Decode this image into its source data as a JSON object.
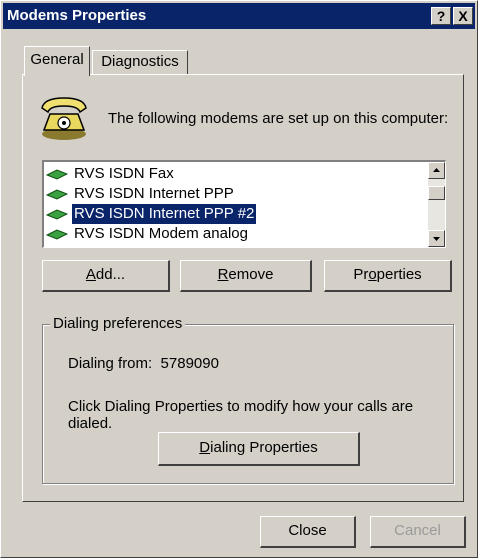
{
  "window": {
    "title": "Modems Properties",
    "help_button": "?",
    "close_button": "X"
  },
  "tabs": [
    {
      "label": "General",
      "active": true
    },
    {
      "label": "Diagnostics",
      "active": false
    }
  ],
  "general": {
    "intro_text": "The following modems are set up on this computer:",
    "modems": [
      {
        "name": "RVS ISDN Fax",
        "selected": false
      },
      {
        "name": "RVS ISDN Internet PPP",
        "selected": false
      },
      {
        "name": "RVS ISDN Internet PPP #2",
        "selected": true
      },
      {
        "name": "RVS ISDN Modem analog",
        "selected": false
      }
    ],
    "buttons": {
      "add": {
        "pre": "",
        "accel": "A",
        "post": "dd..."
      },
      "remove": {
        "pre": "",
        "accel": "R",
        "post": "emove"
      },
      "properties": {
        "pre": "Pr",
        "accel": "o",
        "post": "perties"
      }
    },
    "dialing": {
      "group_title": "Dialing preferences",
      "from_label": "Dialing from:",
      "from_value": "5789090",
      "note": "Click Dialing Properties to modify how your calls are dialed.",
      "button": {
        "pre": "",
        "accel": "D",
        "post": "ialing Properties"
      }
    }
  },
  "footer": {
    "close_label": "Close",
    "cancel_label": "Cancel",
    "cancel_enabled": false
  },
  "colors": {
    "titlebar": "#0a246a",
    "selection": "#0a246a",
    "face": "#d4d0c8"
  },
  "icons": {
    "header_icon": "telephone-icon",
    "modem_item_icon": "modem-icon"
  }
}
